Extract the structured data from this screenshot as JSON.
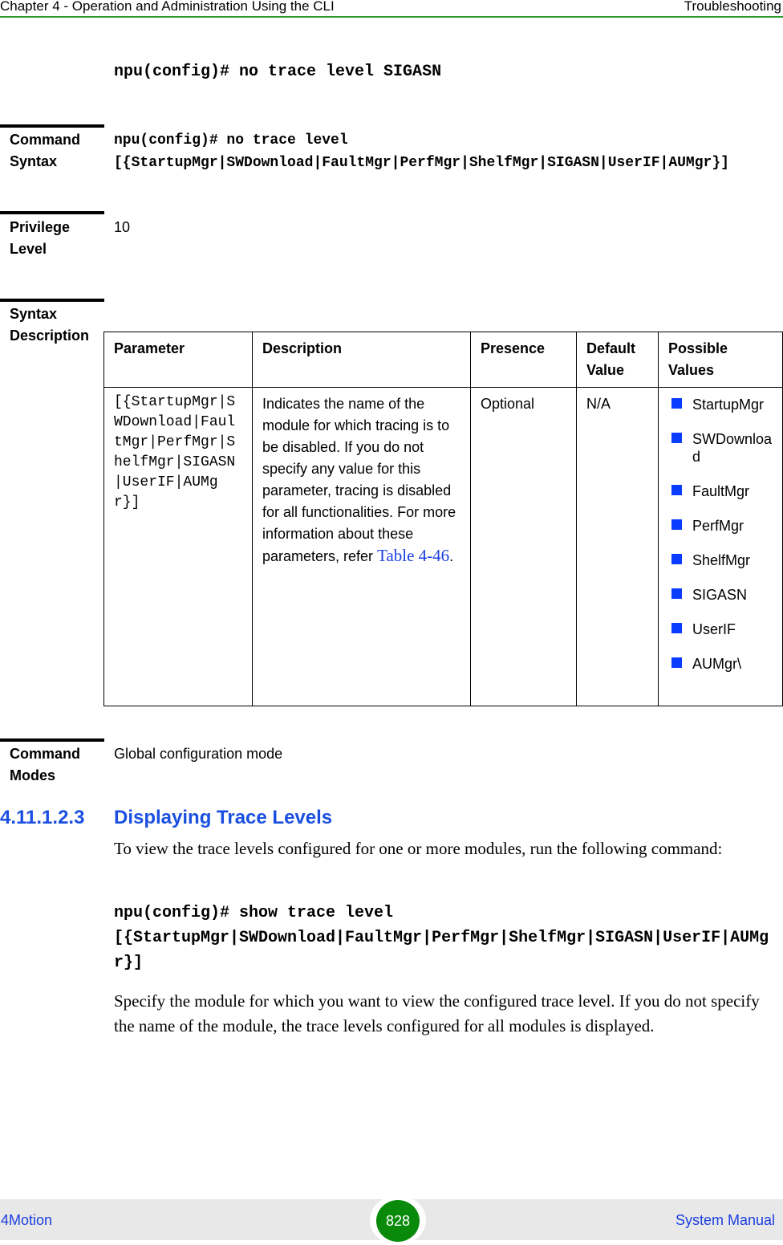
{
  "header": {
    "chapter": "Chapter 4 - Operation and Administration Using the CLI",
    "section": "Troubleshooting"
  },
  "command_example": "npu(config)# no trace level SIGASN",
  "command_syntax": {
    "label_1": "Command",
    "label_2": "Syntax",
    "line1": "npu(config)# no trace level",
    "line2": "[{StartupMgr|SWDownload|FaultMgr|PerfMgr|ShelfMgr|SIGASN|UserIF|AUMgr}]"
  },
  "privilege": {
    "label_1": "Privilege",
    "label_2": "Level",
    "value": "10"
  },
  "syntax_description": {
    "label_1": "Syntax",
    "label_2": "Description",
    "headers": [
      "Parameter",
      "Description",
      "Presence",
      "Default Value",
      "Possible Values"
    ],
    "row": {
      "parameter": "[{StartupMgr|SWDownload|FaultMgr|PerfMgr|ShelfMgr|SIGASN|UserIF|AUMgr}]",
      "description": "Indicates the name of the module for which tracing is to be disabled. If you do not specify any value for this parameter, tracing is disabled for all functionalities. For more information about these parameters, refer",
      "link": "Table 4-46",
      "period": ".",
      "presence": "Optional",
      "default": "N/A",
      "values": [
        "StartupMgr",
        "SWDownload",
        "FaultMgr",
        "PerfMgr",
        "ShelfMgr",
        "SIGASN",
        "UserIF",
        "AUMgr\\"
      ]
    }
  },
  "command_modes": {
    "label_1": "Command",
    "label_2": "Modes",
    "value": "Global configuration mode"
  },
  "section": {
    "number": "4.11.1.2.3",
    "title": "Displaying Trace Levels",
    "intro": "To view the trace levels configured for one or more modules, run the following command:",
    "cmd1": "npu(config)# show trace level",
    "cmd2": "[{StartupMgr|SWDownload|FaultMgr|PerfMgr|ShelfMgr|SIGASN|UserIF|AUMgr}]",
    "body": "Specify the module for which you want to view the configured trace level. If you do not specify the name of the module, the trace levels configured for all modules is displayed."
  },
  "footer": {
    "left": "4Motion",
    "page": "828",
    "right": "System Manual"
  }
}
